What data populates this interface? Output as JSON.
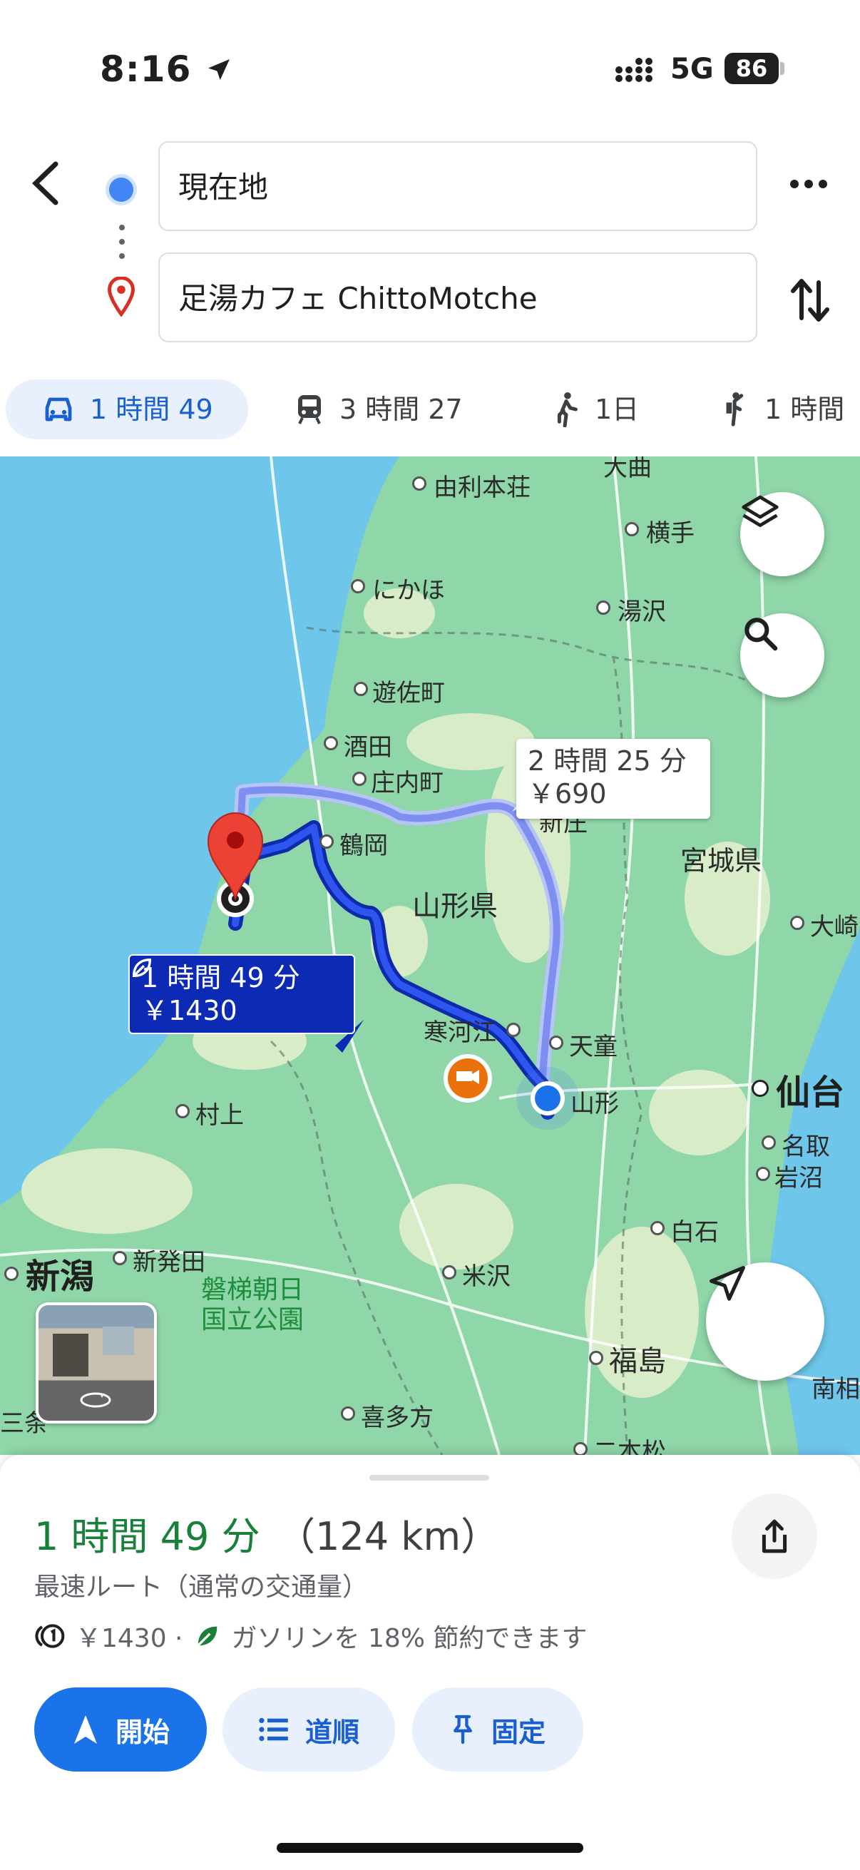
{
  "status_bar": {
    "time": "8:16",
    "network": "5G",
    "battery": "86"
  },
  "header": {
    "origin": "現在地",
    "destination": "足湯カフェ ChittoMotche"
  },
  "modes": [
    {
      "label": "1 時間 49",
      "icon": "car-icon",
      "selected": true
    },
    {
      "label": "3 時間 27",
      "icon": "train-icon"
    },
    {
      "label": "1日",
      "icon": "walk-icon"
    },
    {
      "label": "1 時間",
      "icon": "ride-icon"
    }
  ],
  "map": {
    "labels": {
      "yurihonjo": "由利本荘",
      "yokote": "横手",
      "nikaho": "にかほ",
      "yuzawa": "湯沢",
      "yuza": "遊佐町",
      "sakata": "酒田",
      "shonai": "庄内町",
      "shinjo": "新庄",
      "miyagi": "宮城県",
      "tsuruoka": "鶴岡",
      "yamagata_pref": "山形県",
      "osaki": "大崎",
      "sagae": "寒河江",
      "tendo": "天童",
      "yamagata": "山形",
      "sendai": "仙台",
      "natori": "名取",
      "iwanuma": "岩沼",
      "murakami": "村上",
      "shiroishi": "白石",
      "niigata": "新潟",
      "shibata": "新発田",
      "yonezawa": "米沢",
      "park": "磐梯朝日\n国立公園",
      "fukushima": "福島",
      "kitakata": "喜多方",
      "nihonmatsu": "二本松",
      "minamisoma": "南相",
      "sanjo": "三条",
      "yuri_top": "大曲"
    },
    "callout_main": {
      "time": "1 時間 49 分",
      "fare": "￥1430"
    },
    "callout_alt": {
      "time": "2 時間 25 分",
      "fare": "￥690"
    },
    "colors": {
      "route": "#1a3bd6",
      "alt_route": "#7e8ff0",
      "water": "#6ec6ea",
      "land": "#8fd6a8"
    }
  },
  "sheet": {
    "time": "1 時間 49 分",
    "distance": "（124 km）",
    "description": "最速ルート（通常の交通量）",
    "toll": "￥1430 ·",
    "eco": "ガソリンを 18% 節約できます",
    "buttons": {
      "start": "開始",
      "steps": "道順",
      "pin": "固定"
    }
  }
}
